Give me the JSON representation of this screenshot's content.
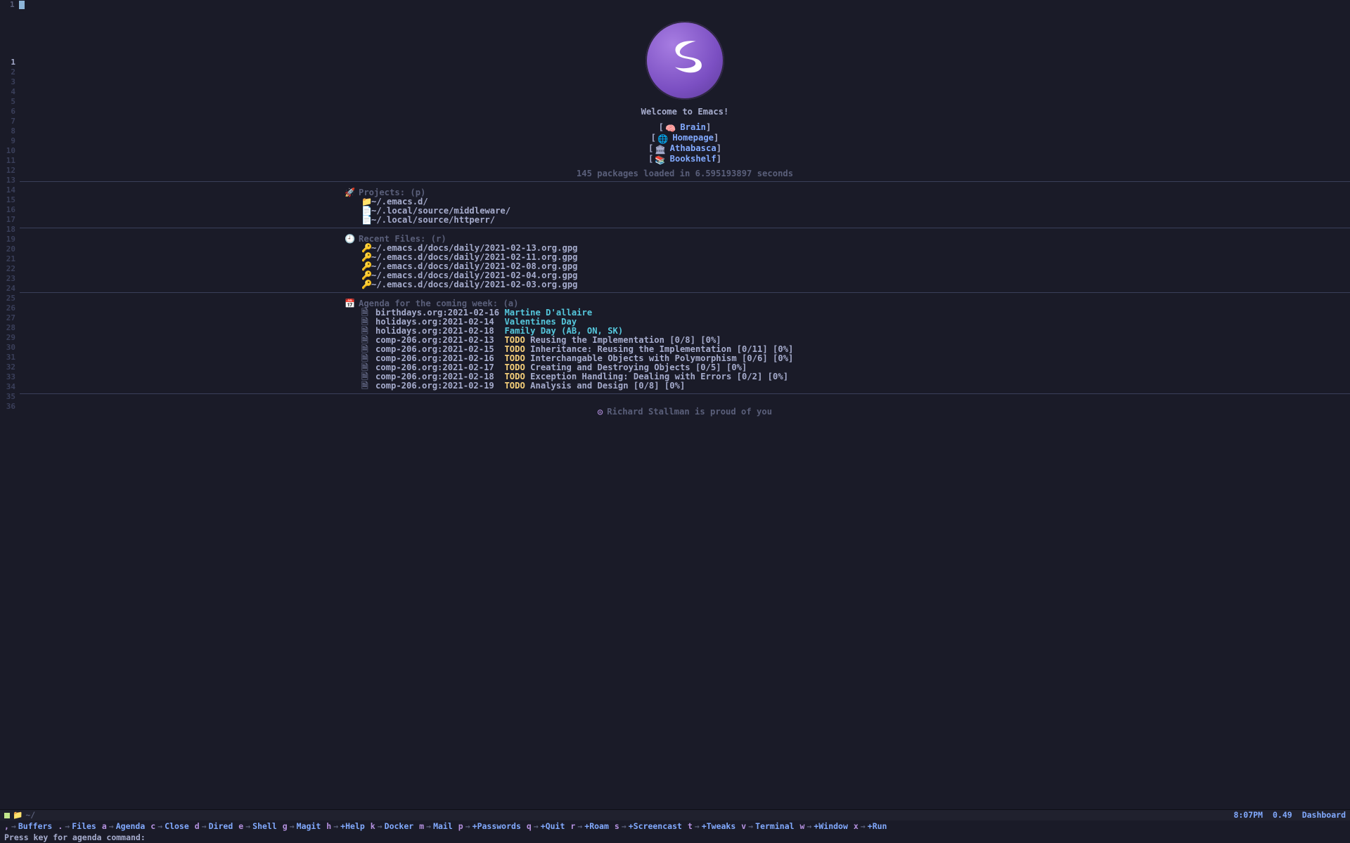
{
  "tab_number": "1",
  "welcome": "Welcome to Emacs!",
  "quicklinks": [
    {
      "label": "Brain"
    },
    {
      "label": "Homepage"
    },
    {
      "label": "Athabasca"
    },
    {
      "label": "Bookshelf"
    }
  ],
  "packages_line": "145 packages loaded in 6.595193897 seconds",
  "sections": {
    "projects": {
      "header": "Projects: (p)",
      "items": [
        "~/.emacs.d/",
        "~/.local/source/middleware/",
        "~/.local/source/httperr/"
      ]
    },
    "recent": {
      "header": "Recent Files: (r)",
      "items": [
        "~/.emacs.d/docs/daily/2021-02-13.org.gpg",
        "~/.emacs.d/docs/daily/2021-02-11.org.gpg",
        "~/.emacs.d/docs/daily/2021-02-08.org.gpg",
        "~/.emacs.d/docs/daily/2021-02-04.org.gpg",
        "~/.emacs.d/docs/daily/2021-02-03.org.gpg"
      ]
    },
    "agenda": {
      "header": "Agenda for the coming week: (a)",
      "items": [
        {
          "src": "birthdays.org:2021-02-16",
          "todo": "",
          "special": "Martine D'allaire",
          "title": ""
        },
        {
          "src": "holidays.org:2021-02-14",
          "todo": "",
          "special": "Valentines Day",
          "title": ""
        },
        {
          "src": "holidays.org:2021-02-18",
          "todo": "",
          "special": "Family Day (AB, ON, SK)",
          "title": ""
        },
        {
          "src": "comp-206.org:2021-02-13",
          "todo": "TODO",
          "special": "",
          "title": "Reusing the Implementation [0/8] [0%]"
        },
        {
          "src": "comp-206.org:2021-02-15",
          "todo": "TODO",
          "special": "",
          "title": "Inheritance: Reusing the Implementation [0/11] [0%]"
        },
        {
          "src": "comp-206.org:2021-02-16",
          "todo": "TODO",
          "special": "",
          "title": "Interchangable Objects with Polymorphism [0/6] [0%]"
        },
        {
          "src": "comp-206.org:2021-02-17",
          "todo": "TODO",
          "special": "",
          "title": "Creating and Destroying Objects [0/5] [0%]"
        },
        {
          "src": "comp-206.org:2021-02-18",
          "todo": "TODO",
          "special": "",
          "title": "Exception Handling: Dealing with Errors [0/2] [0%]"
        },
        {
          "src": "comp-206.org:2021-02-19",
          "todo": "TODO",
          "special": "",
          "title": "Analysis and Design [0/8] [0%]"
        }
      ]
    }
  },
  "footer_quote": "Richard Stallman is proud of you",
  "modeline": {
    "cwd": "~/",
    "time": "8:07PM",
    "load": "0.49",
    "mode": "Dashboard"
  },
  "whichkey": [
    {
      "k": ",",
      "lbl": "Buffers"
    },
    {
      "k": ".",
      "lbl": "Files"
    },
    {
      "k": "a",
      "lbl": "Agenda"
    },
    {
      "k": "c",
      "lbl": "Close"
    },
    {
      "k": "d",
      "lbl": "Dired"
    },
    {
      "k": "e",
      "lbl": "Shell"
    },
    {
      "k": "g",
      "lbl": "Magit"
    },
    {
      "k": "h",
      "lbl": "+Help"
    },
    {
      "k": "k",
      "lbl": "Docker"
    },
    {
      "k": "m",
      "lbl": "Mail"
    },
    {
      "k": "p",
      "lbl": "+Passwords"
    },
    {
      "k": "q",
      "lbl": "+Quit"
    },
    {
      "k": "r",
      "lbl": "+Roam"
    },
    {
      "k": "s",
      "lbl": "+Screencast"
    },
    {
      "k": "t",
      "lbl": "+Tweaks"
    },
    {
      "k": "v",
      "lbl": "Terminal"
    },
    {
      "k": "w",
      "lbl": "+Window"
    },
    {
      "k": "x",
      "lbl": "+Run"
    }
  ],
  "echo": "Press key for agenda command:",
  "line_numbers": {
    "start": 1,
    "end": 36,
    "current": 1
  }
}
